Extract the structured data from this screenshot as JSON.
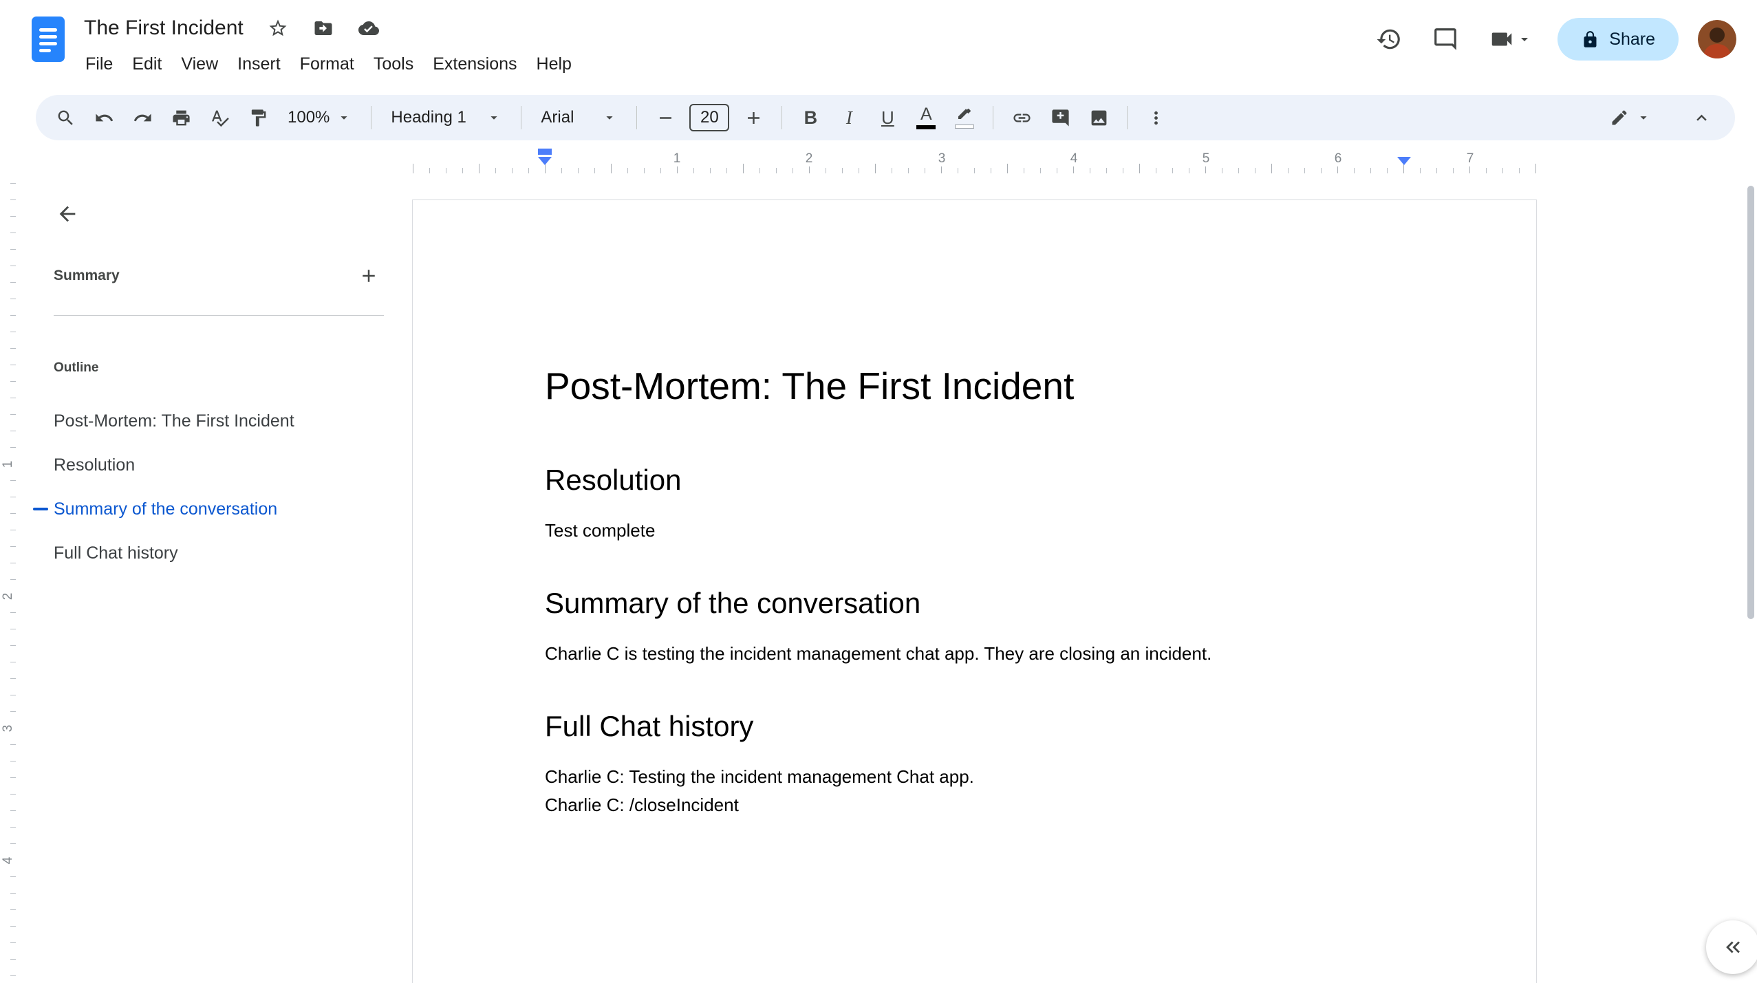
{
  "header": {
    "doc_title": "The First Incident",
    "menu": [
      "File",
      "Edit",
      "View",
      "Insert",
      "Format",
      "Tools",
      "Extensions",
      "Help"
    ],
    "share_label": "Share"
  },
  "toolbar": {
    "zoom_value": "100%",
    "style_value": "Heading 1",
    "font_value": "Arial",
    "font_size_value": "20",
    "bold_label": "B",
    "italic_label": "I",
    "underline_label": "U",
    "text_color_label": "A"
  },
  "rulers": {
    "horizontal_numbers": [
      "1",
      "2",
      "3",
      "4",
      "5",
      "6",
      "7"
    ],
    "vertical_numbers": [
      "1",
      "2",
      "3",
      "4"
    ]
  },
  "sidebar": {
    "summary_label": "Summary",
    "outline_label": "Outline",
    "outline_items": [
      "Post-Mortem: The First Incident",
      "Resolution",
      "Summary of the conversation",
      "Full Chat history"
    ],
    "active_item_index": 2
  },
  "document": {
    "title": "Post-Mortem: The First Incident",
    "sections": [
      {
        "heading": "Resolution",
        "lines": [
          "Test complete"
        ]
      },
      {
        "heading": "Summary of the conversation",
        "lines": [
          "Charlie C is testing the incident management chat app. They are closing an incident."
        ]
      },
      {
        "heading": "Full Chat history",
        "lines": [
          "Charlie C: Testing the incident management Chat app.",
          "Charlie C: /closeIncident"
        ]
      }
    ]
  },
  "colors": {
    "accent_blue": "#0b57d0",
    "toolbar_bg": "#edf2fa",
    "share_bg": "#c2e7ff",
    "docs_logo_blue": "#2684fc",
    "ruler_marker_blue": "#4c7dfa"
  }
}
